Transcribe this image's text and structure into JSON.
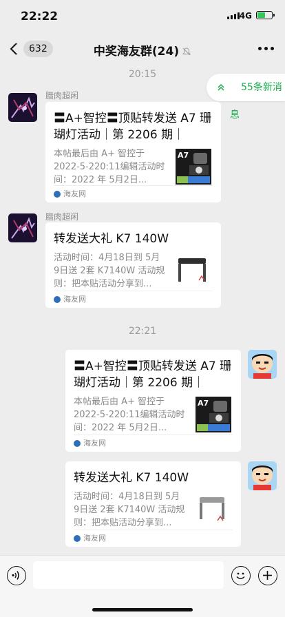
{
  "status": {
    "time": "22:22",
    "network": "4G",
    "battery_level": 0.6
  },
  "nav": {
    "back_count": "632",
    "title": "中奖海友群(24)"
  },
  "timestamps": [
    "20:15",
    "22:21"
  ],
  "new_messages": {
    "label": "55条新消息"
  },
  "messages": [
    {
      "sender": "腊肉超闲",
      "title": "〓A+智控〓顶贴转发送 A7 珊瑚灯活动｜第 2206 期｜",
      "desc": "本帖最后由 A+ 智控于 2022-5-220:11编辑活动时间：2022 年 5月2日...",
      "thumb_text": "A7",
      "source": "海友网"
    },
    {
      "sender": "腊肉超闲",
      "title": "转发送大礼 K7 140W",
      "desc": "活动时间：4月18日到 5月 9日送 2套 K7140W 活动规则：把本贴活动分享到...",
      "source": "海友网"
    },
    {
      "title": "〓A+智控〓顶贴转发送 A7 珊瑚灯活动｜第 2206 期｜",
      "desc": "本帖最后由 A+ 智控于 2022-5-220:11编辑活动时间：2022 年 5月2日...",
      "thumb_text": "A7",
      "source": "海友网"
    },
    {
      "title": "转发送大礼 K7 140W",
      "desc": "活动时间：4月18日到 5月 9日送 2套 K7140W 活动规则：把本贴活动分享到...",
      "source": "海友网"
    }
  ]
}
